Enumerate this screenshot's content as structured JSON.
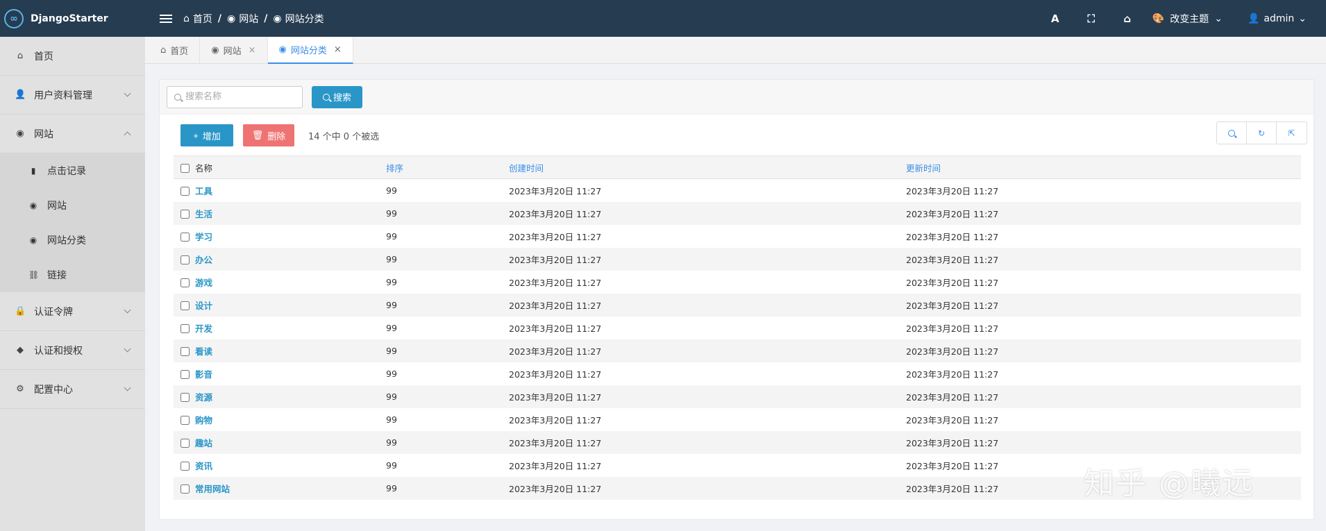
{
  "app": {
    "title": "DjangoStarter",
    "logo_glyph": "∞"
  },
  "breadcrumb": [
    {
      "label": "首页",
      "icon": "home-icon"
    },
    {
      "label": "网站",
      "icon": "globe-icon"
    },
    {
      "label": "网站分类",
      "icon": "globe-icon"
    }
  ],
  "topbar": {
    "font_glyph": "A",
    "fullscreen_glyph": "⛶",
    "home_glyph": "⌂",
    "theme_label": "改变主题",
    "user_label": "admin"
  },
  "sidebar": {
    "items": [
      {
        "label": "首页",
        "icon": "home-icon",
        "glyph": "⌂"
      },
      {
        "label": "用户资料管理",
        "icon": "user-icon",
        "glyph": "👤"
      },
      {
        "label": "网站",
        "icon": "globe-icon",
        "glyph": "◉"
      },
      {
        "label": "认证令牌",
        "icon": "lock-icon",
        "glyph": "🔒"
      },
      {
        "label": "认证和授权",
        "icon": "shield-icon",
        "glyph": "◆"
      },
      {
        "label": "配置中心",
        "icon": "gear-icon",
        "glyph": "⚙"
      }
    ],
    "sub_items": [
      {
        "label": "点击记录",
        "icon": "bookmark-icon",
        "glyph": "▮"
      },
      {
        "label": "网站",
        "icon": "globe-icon",
        "glyph": "◉"
      },
      {
        "label": "网站分类",
        "icon": "globe-icon",
        "glyph": "◉"
      },
      {
        "label": "链接",
        "icon": "link-icon",
        "glyph": "⛓"
      }
    ]
  },
  "tabs": [
    {
      "label": "首页",
      "glyph": "⌂",
      "close": ""
    },
    {
      "label": "网站",
      "glyph": "◉",
      "close": "×"
    },
    {
      "label": "网站分类",
      "glyph": "◉",
      "close": "×"
    }
  ],
  "search": {
    "placeholder": "搜索名称",
    "button_label": "搜索"
  },
  "actions": {
    "add_label": "增加",
    "add_glyph": "+",
    "delete_label": "删除",
    "delete_glyph": "🗑",
    "selection_text": "14 个中 0 个被选"
  },
  "table": {
    "columns": [
      "名称",
      "排序",
      "创建时间",
      "更新时间"
    ],
    "rows": [
      {
        "name": "工具",
        "sort": "99",
        "created": "2023年3月20日 11:27",
        "updated": "2023年3月20日 11:27"
      },
      {
        "name": "生活",
        "sort": "99",
        "created": "2023年3月20日 11:27",
        "updated": "2023年3月20日 11:27"
      },
      {
        "name": "学习",
        "sort": "99",
        "created": "2023年3月20日 11:27",
        "updated": "2023年3月20日 11:27"
      },
      {
        "name": "办公",
        "sort": "99",
        "created": "2023年3月20日 11:27",
        "updated": "2023年3月20日 11:27"
      },
      {
        "name": "游戏",
        "sort": "99",
        "created": "2023年3月20日 11:27",
        "updated": "2023年3月20日 11:27"
      },
      {
        "name": "设计",
        "sort": "99",
        "created": "2023年3月20日 11:27",
        "updated": "2023年3月20日 11:27"
      },
      {
        "name": "开发",
        "sort": "99",
        "created": "2023年3月20日 11:27",
        "updated": "2023年3月20日 11:27"
      },
      {
        "name": "看读",
        "sort": "99",
        "created": "2023年3月20日 11:27",
        "updated": "2023年3月20日 11:27"
      },
      {
        "name": "影音",
        "sort": "99",
        "created": "2023年3月20日 11:27",
        "updated": "2023年3月20日 11:27"
      },
      {
        "name": "资源",
        "sort": "99",
        "created": "2023年3月20日 11:27",
        "updated": "2023年3月20日 11:27"
      },
      {
        "name": "购物",
        "sort": "99",
        "created": "2023年3月20日 11:27",
        "updated": "2023年3月20日 11:27"
      },
      {
        "name": "趣站",
        "sort": "99",
        "created": "2023年3月20日 11:27",
        "updated": "2023年3月20日 11:27"
      },
      {
        "name": "资讯",
        "sort": "99",
        "created": "2023年3月20日 11:27",
        "updated": "2023年3月20日 11:27"
      },
      {
        "name": "常用网站",
        "sort": "99",
        "created": "2023年3月20日 11:27",
        "updated": "2023年3月20日 11:27"
      }
    ]
  },
  "watermark": "知乎 @曦远",
  "colors": {
    "topbar": "#263c51",
    "accent": "#2a96c8",
    "danger": "#f07373",
    "link": "#3a8ee6"
  }
}
